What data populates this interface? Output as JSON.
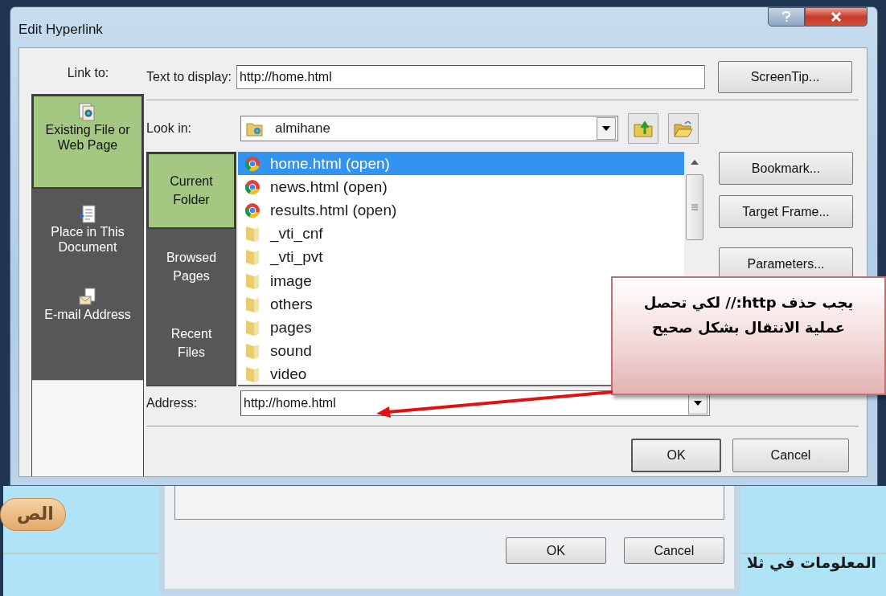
{
  "window": {
    "title": "Edit Hyperlink"
  },
  "link_to": {
    "label": "Link to:",
    "items": [
      {
        "label": "Existing File or Web Page",
        "kind": "file",
        "selected": true
      },
      {
        "label": "Place in This Document",
        "kind": "place",
        "selected": false
      },
      {
        "label": "E-mail Address",
        "kind": "email",
        "selected": false
      }
    ]
  },
  "text_to_display": {
    "label": "Text to display:",
    "value": "http://home.html"
  },
  "screentip_button": "ScreenTip...",
  "look_in": {
    "label": "Look in:",
    "value": "almihane"
  },
  "nav_items": [
    {
      "label": "Current Folder",
      "selected": true
    },
    {
      "label": "Browsed Pages",
      "selected": false
    },
    {
      "label": "Recent Files",
      "selected": false
    }
  ],
  "files": [
    {
      "name": "home.html (open)",
      "kind": "web",
      "selected": true
    },
    {
      "name": "news.html (open)",
      "kind": "web",
      "selected": false
    },
    {
      "name": "results.html (open)",
      "kind": "web",
      "selected": false
    },
    {
      "name": "_vti_cnf",
      "kind": "folder",
      "selected": false
    },
    {
      "name": "_vti_pvt",
      "kind": "folder",
      "selected": false
    },
    {
      "name": "image",
      "kind": "folder",
      "selected": false
    },
    {
      "name": "others",
      "kind": "folder",
      "selected": false
    },
    {
      "name": "pages",
      "kind": "folder",
      "selected": false
    },
    {
      "name": "sound",
      "kind": "folder",
      "selected": false
    },
    {
      "name": "video",
      "kind": "folder",
      "selected": false
    }
  ],
  "side_buttons": [
    "Bookmark...",
    "Target Frame...",
    "Parameters..."
  ],
  "address": {
    "label": "Address:",
    "value": "http://home.html"
  },
  "buttons": [
    "OK",
    "Cancel"
  ],
  "callout": {
    "text": "يجب حذف http:// لكي تحصل\nعملية الانتقال بشكل صحيح"
  },
  "background": {
    "pill": "الص",
    "back_dialog_buttons": [
      "OK",
      "Cancel"
    ],
    "text": "المعلومات في ثلا"
  }
}
